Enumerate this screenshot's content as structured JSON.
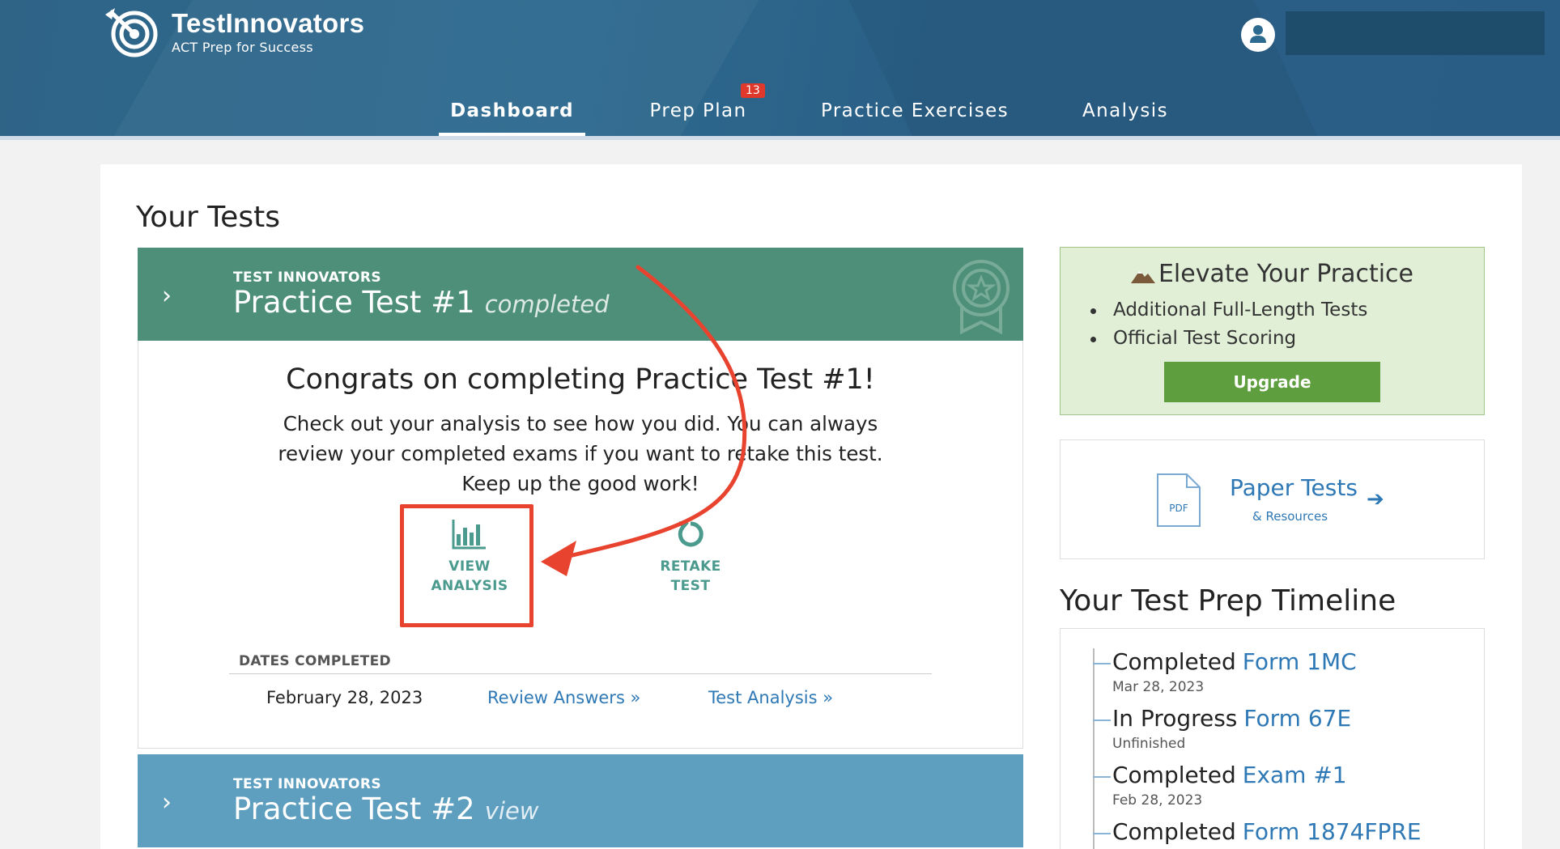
{
  "header": {
    "brand_name": "TestInnovators",
    "tagline": "ACT Prep for Success",
    "nav": [
      {
        "label": "Dashboard",
        "active": true
      },
      {
        "label": "Prep Plan",
        "badge": "13"
      },
      {
        "label": "Practice Exercises"
      },
      {
        "label": "Analysis"
      }
    ]
  },
  "main": {
    "heading": "Your Tests",
    "tests": [
      {
        "brand_label": "TEST INNOVATORS",
        "title": "Practice Test #1",
        "status": "completed",
        "congrats": "Congrats on completing Practice Test #1!",
        "description": "Check out your analysis to see how you did. You can always review your completed exams if you want to retake this test. Keep up the good work!",
        "actions": {
          "view_line1": "VIEW",
          "view_line2": "ANALYSIS",
          "retake_line1": "RETAKE",
          "retake_line2": "TEST"
        },
        "dates_label": "DATES COMPLETED",
        "date": "February 28, 2023",
        "review_link": "Review Answers »",
        "analysis_link": "Test Analysis »"
      },
      {
        "brand_label": "TEST INNOVATORS",
        "title": "Practice Test #2",
        "status": "view"
      }
    ]
  },
  "sidebar": {
    "elevate": {
      "heading": "Elevate Your Practice",
      "items": [
        "Additional Full-Length Tests",
        "Official Test Scoring"
      ],
      "button": "Upgrade"
    },
    "paper": {
      "icon_label": "PDF",
      "title": "Paper Tests",
      "subtitle": "& Resources"
    },
    "timeline": {
      "heading": "Your Test Prep Timeline",
      "items": [
        {
          "status": "Completed",
          "form": "Form 1MC",
          "sub": "Mar 28, 2023"
        },
        {
          "status": "In Progress",
          "form": "Form 67E",
          "sub": "Unfinished"
        },
        {
          "status": "Completed",
          "form": "Exam #1",
          "sub": "Feb 28, 2023"
        },
        {
          "status": "Completed",
          "form": "Form 1874FPRE",
          "sub": ""
        }
      ]
    }
  },
  "colors": {
    "header": "#2c6a8f",
    "test_completed": "#4e8f79",
    "test_view": "#5e9fbf",
    "accent_teal": "#4b9a8e",
    "link": "#2e78b5",
    "upgrade": "#5f9e3f",
    "annotation": "#e8432f"
  }
}
